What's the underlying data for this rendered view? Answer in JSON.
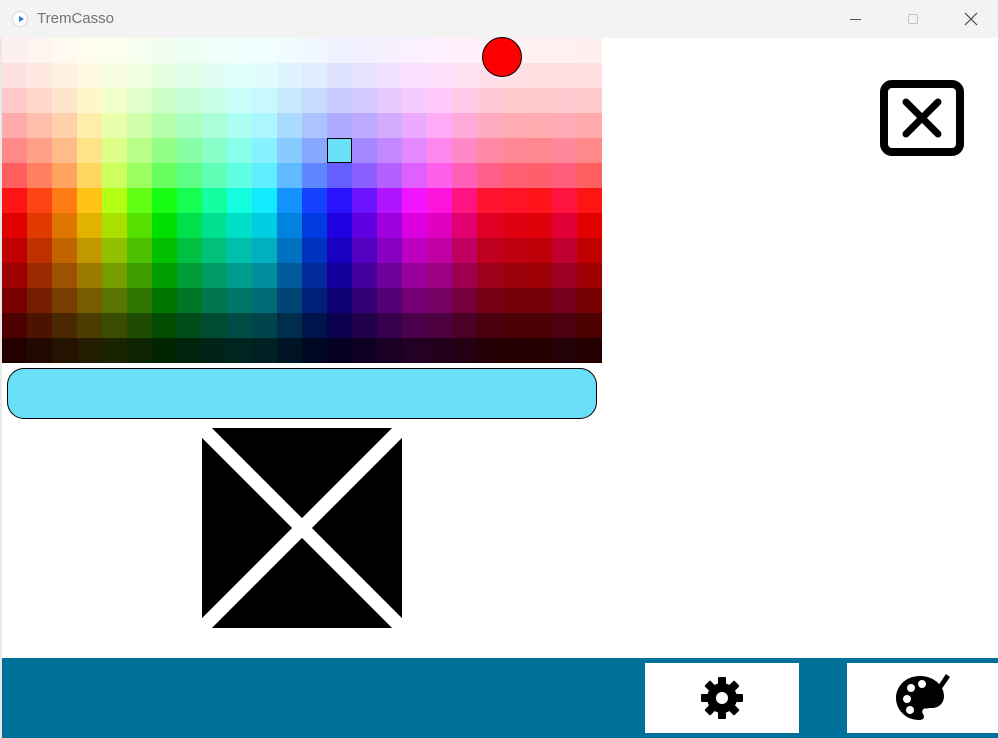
{
  "window": {
    "title": "TremCasso"
  },
  "colors": {
    "titlebar_bg": "#f3f3f3",
    "bottom_bar": "#00719a",
    "selected_color": "#6ae0f8",
    "marker_color": "#ff0000"
  },
  "palette": {
    "rows": [
      [
        "#fff0f0",
        "#fff5f0",
        "#fff9f0",
        "#fffcf0",
        "#fcfff0",
        "#f7fff0",
        "#f2fff0",
        "#f0fff3",
        "#f0fff8",
        "#f0fffc",
        "#f0feff",
        "#f0fbff",
        "#f0f7ff",
        "#f0f2ff",
        "#f3f0ff",
        "#f7f0ff",
        "#fbf0ff",
        "#fff0ff",
        "#fff0fb",
        "#fff0f7",
        "#fff0f3",
        "#fff0f1",
        "#fff0f1",
        "#fff0f0"
      ],
      [
        "#ffe0e0",
        "#ffe9e0",
        "#fff2e0",
        "#fffbe0",
        "#f8ffe0",
        "#efffe0",
        "#e6ffe0",
        "#e0ffe9",
        "#e0fff2",
        "#e0fffb",
        "#e0fcff",
        "#e0f4ff",
        "#e0ecff",
        "#e0e3ff",
        "#e8e0ff",
        "#f1e0ff",
        "#fae0ff",
        "#ffe0fc",
        "#ffe0f3",
        "#ffe0ea",
        "#ffe0e4",
        "#ffe0e1",
        "#ffe0e2",
        "#ffe0e0"
      ],
      [
        "#ffc9c9",
        "#ffd6c9",
        "#ffe5c9",
        "#fff6c9",
        "#f1ffc9",
        "#e0ffc9",
        "#ceffc9",
        "#c9ffd8",
        "#c9ffe8",
        "#c9fff8",
        "#c9f9ff",
        "#c9e9ff",
        "#c9daff",
        "#c9ccff",
        "#d4c9ff",
        "#e5c9ff",
        "#f6c9ff",
        "#ffc9f9",
        "#ffc9e8",
        "#ffc9d7",
        "#ffc9cd",
        "#ffc9cb",
        "#ffc9cf",
        "#ffc9c9"
      ],
      [
        "#ffabab",
        "#ffbdab",
        "#ffd1ab",
        "#ffeeab",
        "#e9ffab",
        "#d0ffab",
        "#b5ffab",
        "#abffc0",
        "#abffd8",
        "#abfff0",
        "#abf6ff",
        "#abdcff",
        "#abc3ff",
        "#adabff",
        "#bcabff",
        "#d2abff",
        "#eaabff",
        "#ffabf5",
        "#ffabda",
        "#ffabc1",
        "#ffabb4",
        "#ffabb0",
        "#ffabb6",
        "#ffabab"
      ],
      [
        "#ff8888",
        "#ffa088",
        "#ffbb88",
        "#ffe388",
        "#dcff88",
        "#b8ff88",
        "#94ff88",
        "#88ffa6",
        "#88ffc8",
        "#88ffea",
        "#88f1ff",
        "#88ccff",
        "#88a7ff",
        "#8a88ff",
        "#a488ff",
        "#c388ff",
        "#e388ff",
        "#ff88f0",
        "#ff88c9",
        "#ff88a4",
        "#ff8895",
        "#ff8890",
        "#ff889c",
        "#ff8888"
      ],
      [
        "#ff5f5f",
        "#ff7f5f",
        "#ffa35f",
        "#ffd65f",
        "#cdff5f",
        "#9bff5f",
        "#67ff5f",
        "#5fff87",
        "#5fffb5",
        "#5fffe2",
        "#5feeff",
        "#5fbaff",
        "#5f86ff",
        "#665fff",
        "#8b5fff",
        "#b55fff",
        "#df5fff",
        "#ff5fea",
        "#ff5fb8",
        "#ff5f88",
        "#ff5f73",
        "#ff5f6c",
        "#ff5f7c",
        "#ff5f5f"
      ],
      [
        "#ff1414",
        "#ff4414",
        "#ff7c14",
        "#ffc414",
        "#b4ff14",
        "#60ff14",
        "#18ff14",
        "#14ff52",
        "#14ff9f",
        "#14ffe0",
        "#14eaff",
        "#1493ff",
        "#1442ff",
        "#2a14ff",
        "#6c14ff",
        "#b114ff",
        "#f214ff",
        "#ff14db",
        "#ff1481",
        "#ff1430",
        "#ff1428",
        "#ff141c",
        "#ff1440",
        "#ff1414"
      ],
      [
        "#e00000",
        "#e03a00",
        "#e07600",
        "#e0b300",
        "#aae000",
        "#56e000",
        "#00e000",
        "#00e04c",
        "#00e090",
        "#00e0c8",
        "#00cde0",
        "#0082e0",
        "#003ae0",
        "#1f00e0",
        "#6000e0",
        "#9e00e0",
        "#dc00e0",
        "#e000bf",
        "#e00070",
        "#e00026",
        "#e00012",
        "#e0000a",
        "#e00036",
        "#e00000"
      ],
      [
        "#c00000",
        "#c03100",
        "#c06400",
        "#c09800",
        "#91c000",
        "#4bc000",
        "#00c000",
        "#00c041",
        "#00c07c",
        "#00c0ac",
        "#00afc0",
        "#0070c0",
        "#0032c0",
        "#1a00c0",
        "#5300c0",
        "#8800c0",
        "#bd00c0",
        "#c000a3",
        "#c00060",
        "#c00020",
        "#c00010",
        "#c00008",
        "#c0002e",
        "#c00000"
      ],
      [
        "#9c0000",
        "#9c2800",
        "#9c5200",
        "#9c7b00",
        "#769c00",
        "#3d9c00",
        "#009c00",
        "#009c35",
        "#009c65",
        "#009c8c",
        "#008e9c",
        "#005b9c",
        "#00299c",
        "#15009c",
        "#43009c",
        "#6f009c",
        "#9a009c",
        "#9c0085",
        "#9c004e",
        "#9c001a",
        "#9c000d",
        "#9c0006",
        "#9c0025",
        "#9c0000"
      ],
      [
        "#760000",
        "#761e00",
        "#763e00",
        "#765d00",
        "#597600",
        "#2e7600",
        "#007600",
        "#007628",
        "#00764c",
        "#00766a",
        "#006b76",
        "#004576",
        "#001f76",
        "#100076",
        "#330076",
        "#540076",
        "#740076",
        "#760064",
        "#76003b",
        "#760014",
        "#76000a",
        "#760005",
        "#76001c",
        "#760000"
      ],
      [
        "#4c0000",
        "#4c1300",
        "#4c2800",
        "#4c3c00",
        "#394c00",
        "#1e4c00",
        "#004c00",
        "#004c1a",
        "#004c31",
        "#004c44",
        "#00454c",
        "#002d4c",
        "#00144c",
        "#0a004c",
        "#21004c",
        "#36004c",
        "#4b004c",
        "#4c0040",
        "#4c0026",
        "#4c000d",
        "#4c0006",
        "#4c0003",
        "#4c0012",
        "#4c0000"
      ],
      [
        "#240000",
        "#240900",
        "#241300",
        "#241c00",
        "#1b2400",
        "#0e2400",
        "#002400",
        "#00240c",
        "#002417",
        "#002420",
        "#002124",
        "#001524",
        "#000924",
        "#050024",
        "#100024",
        "#1a0024",
        "#240024",
        "#24001f",
        "#240012",
        "#240006",
        "#240003",
        "#240001",
        "#240009",
        "#240000"
      ]
    ]
  }
}
